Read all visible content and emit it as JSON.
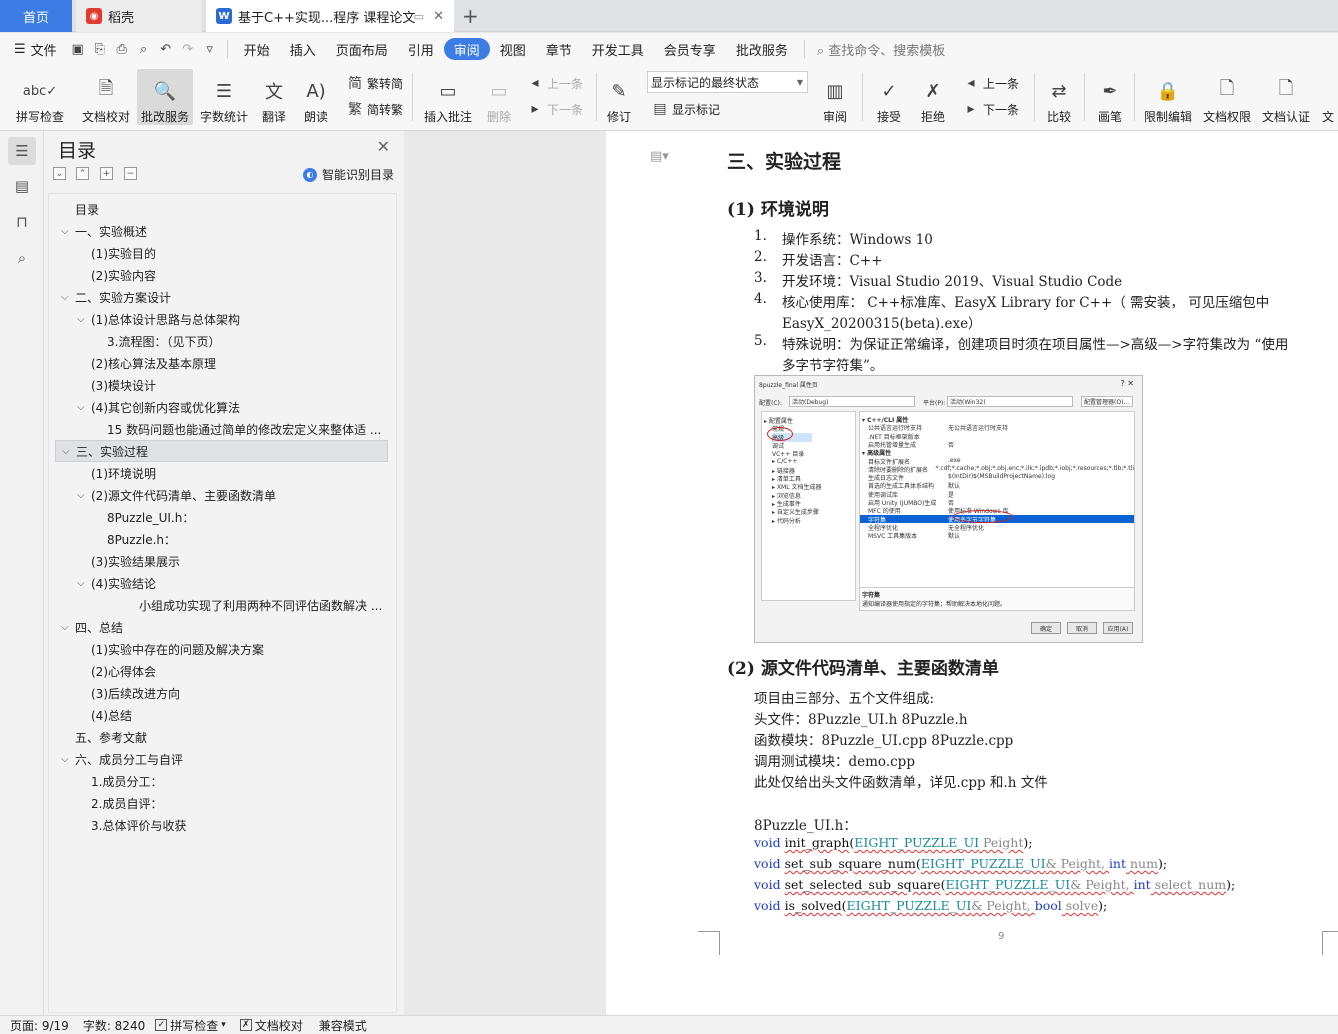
{
  "tabs": {
    "home": "首页",
    "daoke": "稻壳",
    "doc": "基于C++实现...程序 课程论文",
    "new_tab": "+"
  },
  "menubar": {
    "file": "文件",
    "items": [
      "开始",
      "插入",
      "页面布局",
      "引用",
      "审阅",
      "视图",
      "章节",
      "开发工具",
      "会员专享",
      "批改服务"
    ],
    "active": "审阅",
    "search_placeholder": "查找命令、搜索模板"
  },
  "ribbon": {
    "spell_check": "拼写检查",
    "doc_proof": "文档校对",
    "review_service": "批改服务",
    "word_count": "字数统计",
    "translate": "翻译",
    "read_aloud": "朗读",
    "trad_simp": "繁转简",
    "simp_trad": "简转繁",
    "insert_comment": "插入批注",
    "delete": "删除",
    "prev_comment": "上一条",
    "next_comment": "下一条",
    "track": "修订",
    "show_state": "显示标记的最终状态",
    "show_marks": "显示标记",
    "review": "审阅",
    "accept": "接受",
    "reject": "拒绝",
    "prev": "上一条",
    "next": "下一条",
    "compare": "比较",
    "pen": "画笔",
    "restrict_edit": "限制编辑",
    "doc_permission": "文档权限",
    "doc_cert": "文档认证",
    "more": "文"
  },
  "toc": {
    "title": "目录",
    "smart": "智能识别目录",
    "items": [
      {
        "label": "目录",
        "level": 0,
        "chev": ""
      },
      {
        "label": "一、实验概述",
        "level": 0,
        "chev": "v"
      },
      {
        "label": "(1)实验目的",
        "level": 1,
        "chev": ""
      },
      {
        "label": "(2)实验内容",
        "level": 1,
        "chev": ""
      },
      {
        "label": "二、实验方案设计",
        "level": 0,
        "chev": "v"
      },
      {
        "label": "(1)总体设计思路与总体架构",
        "level": 1,
        "chev": "v"
      },
      {
        "label": "3.流程图：（见下页）",
        "level": 2,
        "chev": ""
      },
      {
        "label": "(2)核心算法及基本原理",
        "level": 1,
        "chev": ""
      },
      {
        "label": "(3)模块设计",
        "level": 1,
        "chev": ""
      },
      {
        "label": "(4)其它创新内容或优化算法",
        "level": 1,
        "chev": "v"
      },
      {
        "label": "15 数码问题也能通过简单的修改宏定义来整体适 ...",
        "level": 2,
        "chev": ""
      },
      {
        "label": "三、实验过程",
        "level": 0,
        "chev": "v"
      },
      {
        "label": "(1)环境说明",
        "level": 1,
        "chev": ""
      },
      {
        "label": "(2)源文件代码清单、主要函数清单",
        "level": 1,
        "chev": "v"
      },
      {
        "label": "8Puzzle_UI.h：",
        "level": 2,
        "chev": ""
      },
      {
        "label": "8Puzzle.h：",
        "level": 2,
        "chev": ""
      },
      {
        "label": "(3)实验结果展示",
        "level": 1,
        "chev": ""
      },
      {
        "label": "(4)实验结论",
        "level": 1,
        "chev": "v"
      },
      {
        "label": "小组成功实现了利用两种不同评估函数解决 ...",
        "level": 3,
        "chev": ""
      },
      {
        "label": "四、总结",
        "level": 0,
        "chev": "v"
      },
      {
        "label": "(1)实验中存在的问题及解决方案",
        "level": 1,
        "chev": ""
      },
      {
        "label": "(2)心得体会",
        "level": 1,
        "chev": ""
      },
      {
        "label": "(3)后续改进方向",
        "level": 1,
        "chev": ""
      },
      {
        "label": "(4)总结",
        "level": 1,
        "chev": ""
      },
      {
        "label": "五、参考文献",
        "level": 0,
        "chev": ""
      },
      {
        "label": "六、成员分工与自评",
        "level": 0,
        "chev": "v"
      },
      {
        "label": "1.成员分工：",
        "level": 1,
        "chev": ""
      },
      {
        "label": "2.成员自评：",
        "level": 1,
        "chev": ""
      },
      {
        "label": "3.总体评价与收获",
        "level": 1,
        "chev": ""
      }
    ],
    "highlighted_index": 11
  },
  "document": {
    "section_title": "三、实验过程",
    "sub1_title": "(1) 环境说明",
    "env_items": [
      {
        "num": "1.",
        "text": "操作系统：Windows 10"
      },
      {
        "num": "2.",
        "text": "开发语言：C++"
      },
      {
        "num": "3.",
        "text": "开发环境：Visual Studio 2019、Visual Studio Code"
      },
      {
        "num": "4.",
        "text": "核心使用库：  C++标准库、EasyX Library for C++（  需安装，  可见压缩包中"
      },
      {
        "num": "",
        "text": "EasyX_20200315(beta).exe）"
      },
      {
        "num": "5.",
        "text": "特殊说明：为保证正常编译，创建项目时须在项目属性—>高级—>字符集改为 “使用"
      },
      {
        "num": "",
        "text": "多字节字符集”。"
      }
    ],
    "sub2_title": "(2) 源文件代码清单、主要函数清单",
    "source_lines": [
      "项目由三部分、五个文件组成:",
      "头文件：8Puzzle_UI.h      8Puzzle.h",
      "函数模块：8Puzzle_UI.cpp      8Puzzle.cpp",
      "调用测试模块：demo.cpp",
      "此处仅给出头文件函数清单，详见.cpp 和.h 文件"
    ],
    "header_label": "8Puzzle_UI.h：",
    "page_number": "9"
  },
  "code": [
    {
      "kw": "void",
      "name": "init_graph",
      "args": [
        {
          "ty": "EIGHT_PUZZLE_UI",
          "rest": " Peight"
        }
      ],
      "tail": ");"
    },
    {
      "kw": "void",
      "name": "set_sub_square_num",
      "args": [
        {
          "ty": "EIGHT_PUZZLE_UI",
          "rest": "& Peight, "
        },
        {
          "kw": "int",
          "rest": " num"
        }
      ],
      "tail": ");"
    },
    {
      "kw": "void",
      "name": "set_selected_sub_square",
      "args": [
        {
          "ty": "EIGHT_PUZZLE_UI",
          "rest": "& Peight, "
        },
        {
          "kw": "int",
          "rest": " select_num"
        }
      ],
      "tail": ");"
    },
    {
      "kw": "void",
      "name": "is_solved",
      "args": [
        {
          "ty": "EIGHT_PUZZLE_UI",
          "rest": "& Peight, "
        },
        {
          "kw": "bool",
          "rest": " solve"
        }
      ],
      "tail": ");"
    }
  ],
  "figure": {
    "title": "8puzzle_final 属性页",
    "config_label": "配置(C):",
    "config_value": "活动(Debug)",
    "platform_label": "平台(P):",
    "platform_value": "活动(Win32)",
    "config_manager": "配置管理器(O)...",
    "tree": [
      "▸ 配置属性",
      "常规",
      "高级",
      "调试",
      "VC++ 目录",
      "▸ C/C++",
      "▸ 链接器",
      "▸ 清单工具",
      "▸ XML 文档生成器",
      "▸ 浏览信息",
      "▸ 生成事件",
      "▸ 自定义生成步骤",
      "▸ 代码分析"
    ],
    "grid": [
      {
        "k": "▾ C++/CLI 属性",
        "v": "",
        "cat": true
      },
      {
        "k": "公共语言运行时支持",
        "v": "无公共语言运行时支持"
      },
      {
        "k": ".NET 目标框架版本",
        "v": ""
      },
      {
        "k": "启用托管增量生成",
        "v": "否"
      },
      {
        "k": "▾ 高级属性",
        "v": "",
        "cat": true
      },
      {
        "k": "目标文件扩展名",
        "v": ".exe"
      },
      {
        "k": "清除时要删除的扩展名",
        "v": "*.cdf;*.cache;*.obj;*.obj.enc;*.ilk;*.ipdb;*.iobj;*.resources;*.tlb;*.tli"
      },
      {
        "k": "生成日志文件",
        "v": "$(IntDir)$(MSBuildProjectName).log"
      },
      {
        "k": "首选的生成工具体系结构",
        "v": "默认"
      },
      {
        "k": "使用调试库",
        "v": "是"
      },
      {
        "k": "启用 Unity (JUMBO)生成",
        "v": "否"
      },
      {
        "k": "MFC 的使用",
        "v": "使用标准 Windows 库"
      },
      {
        "k": "字符集",
        "v": "使用多字节字符集",
        "sel": true
      },
      {
        "k": "全程序优化",
        "v": "无全程序优化"
      },
      {
        "k": "MSVC 工具集版本",
        "v": "默认"
      }
    ],
    "desc_title": "字符集",
    "desc_text": "通知编译器使用指定的字符集；帮助解决本地化问题。",
    "ok": "确定",
    "cancel": "取消",
    "apply": "应用(A)"
  },
  "status": {
    "page": "页面: 9/19",
    "words": "字数: 8240",
    "spell": "拼写检查",
    "proof": "文档校对",
    "compat": "兼容模式"
  }
}
